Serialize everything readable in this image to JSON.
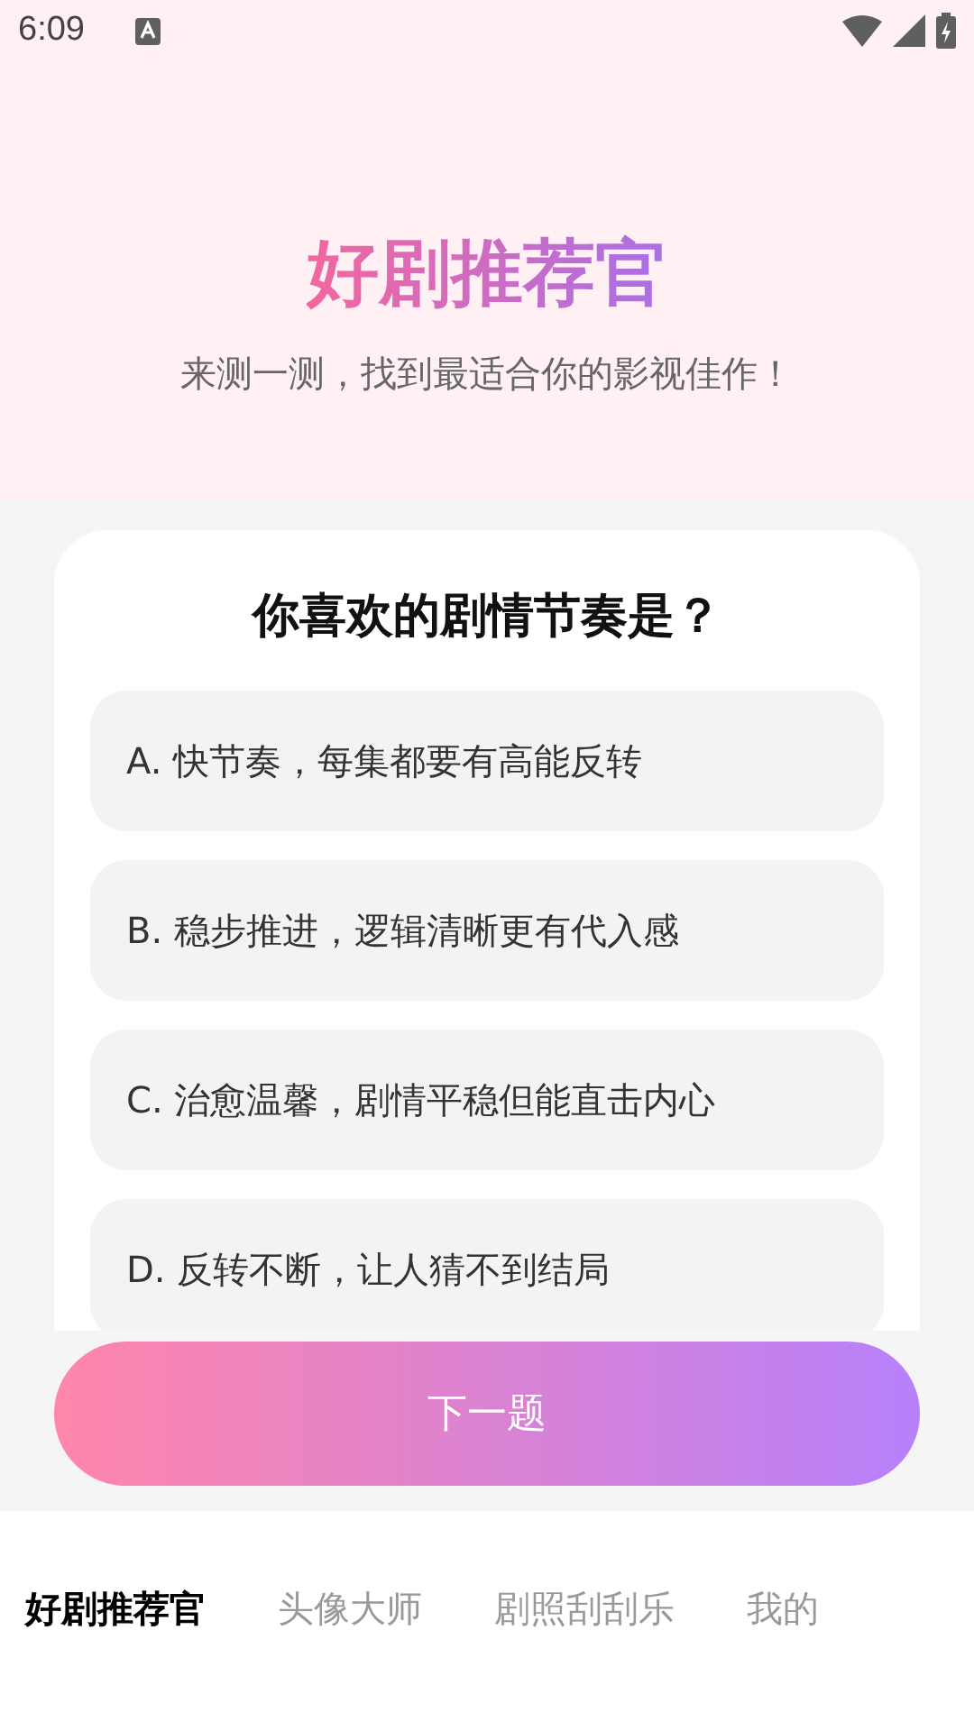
{
  "status_bar": {
    "time": "6:09"
  },
  "header": {
    "title": "好剧推荐官",
    "subtitle": "来测一测，找到最适合你的影视佳作！"
  },
  "question": {
    "text": "你喜欢的剧情节奏是？",
    "options": [
      {
        "label": "A. 快节奏，每集都要有高能反转",
        "selected": false
      },
      {
        "label": "B. 稳步推进，逻辑清晰更有代入感",
        "selected": false
      },
      {
        "label": "C. 治愈温馨，剧情平稳但能直击内心",
        "selected": false
      },
      {
        "label": "D. 反转不断，让人猜不到结局",
        "selected": false
      }
    ]
  },
  "next_button": {
    "label": "下一题"
  },
  "tabs": [
    {
      "label": "好剧推荐官",
      "selected": true
    },
    {
      "label": "头像大师",
      "selected": false
    },
    {
      "label": "剧照刮刮乐",
      "selected": false
    },
    {
      "label": "我的",
      "selected": false
    }
  ]
}
